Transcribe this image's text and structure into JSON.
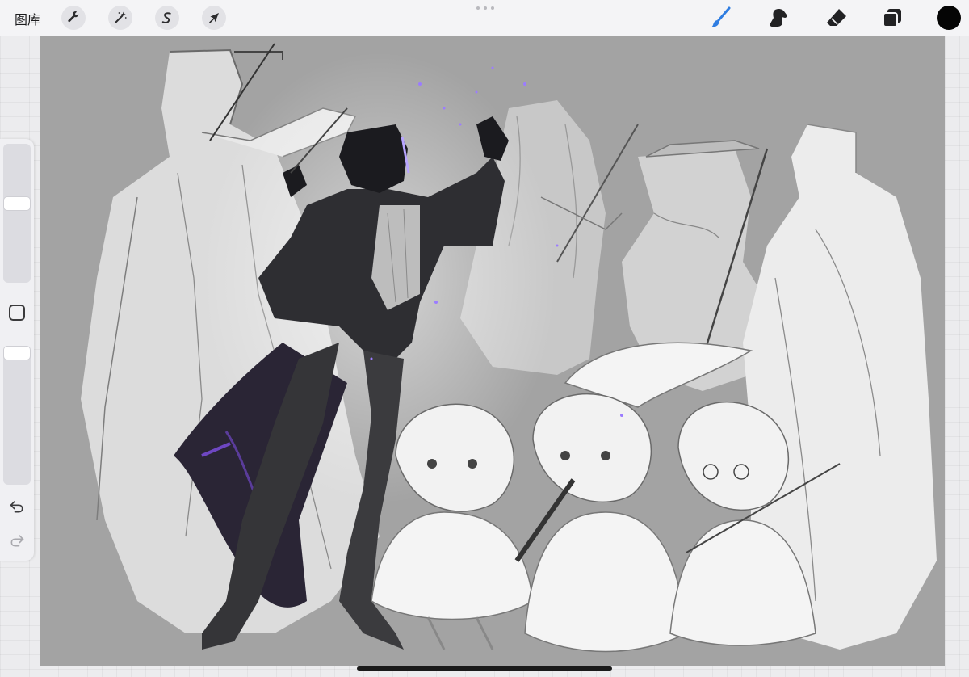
{
  "app": {
    "gallery_label": "图库"
  },
  "toolbar": {
    "left_tools": [
      {
        "name": "actions",
        "icon": "wrench-icon"
      },
      {
        "name": "adjustments",
        "icon": "magic-wand-icon"
      },
      {
        "name": "selection",
        "icon": "selection-s-icon"
      },
      {
        "name": "transform",
        "icon": "arrow-cursor-icon"
      }
    ],
    "right_tools": [
      {
        "name": "brush",
        "icon": "brush-icon",
        "active": true
      },
      {
        "name": "smudge",
        "icon": "smudge-icon",
        "active": false
      },
      {
        "name": "eraser",
        "icon": "eraser-icon",
        "active": false
      },
      {
        "name": "layers",
        "icon": "layers-icon",
        "active": false
      }
    ],
    "current_color": "#050505",
    "accent_color": "#2f7de1"
  },
  "sidebar": {
    "brush_size_level": 0.58,
    "brush_opacity_level": 1.0,
    "icons": [
      "modify-square-icon",
      "undo-icon",
      "redo-icon"
    ]
  },
  "canvas": {
    "background": "#a3a3a3",
    "content": "sketch-artwork"
  }
}
